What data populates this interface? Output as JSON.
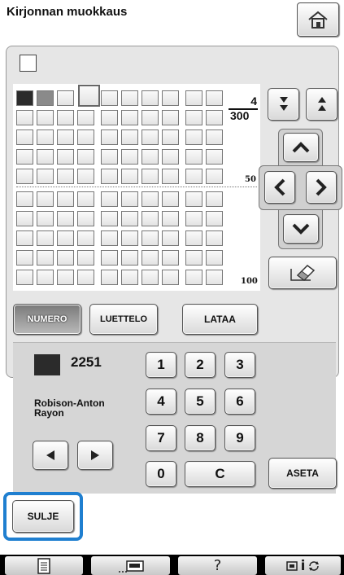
{
  "title": "Kirjonnan muokkaus",
  "colors": {
    "swatch_selected": "#2b2b2b",
    "swatch_2": "#8a8a8a",
    "highlight": "#1f7fd0"
  },
  "palette": {
    "counter_current": "4",
    "counter_total": "300",
    "row_marker_50": "50",
    "row_marker_100": "100"
  },
  "mode_buttons": {
    "numero": "NUMERO",
    "luettelo": "LUETTELO",
    "lataa": "LATAA"
  },
  "thread": {
    "code": "2251",
    "brand": "Robison-Anton\nRayon"
  },
  "keypad": [
    "1",
    "2",
    "3",
    "4",
    "5",
    "6",
    "7",
    "8",
    "9",
    "0",
    "C"
  ],
  "buttons": {
    "aseta": "ASETA",
    "sulje": "SULJE"
  },
  "bottom_bar": {
    "help": "?",
    "info": "i"
  },
  "icons": [
    "home-icon",
    "scroll-down-icon",
    "scroll-up-icon",
    "arrow-up-icon",
    "arrow-left-icon",
    "arrow-right-icon",
    "arrow-down-icon",
    "eraser-icon",
    "triangle-left-icon",
    "triangle-right-icon",
    "page-icon",
    "machine-icon",
    "help-icon",
    "info-icon",
    "rotate-icon"
  ]
}
